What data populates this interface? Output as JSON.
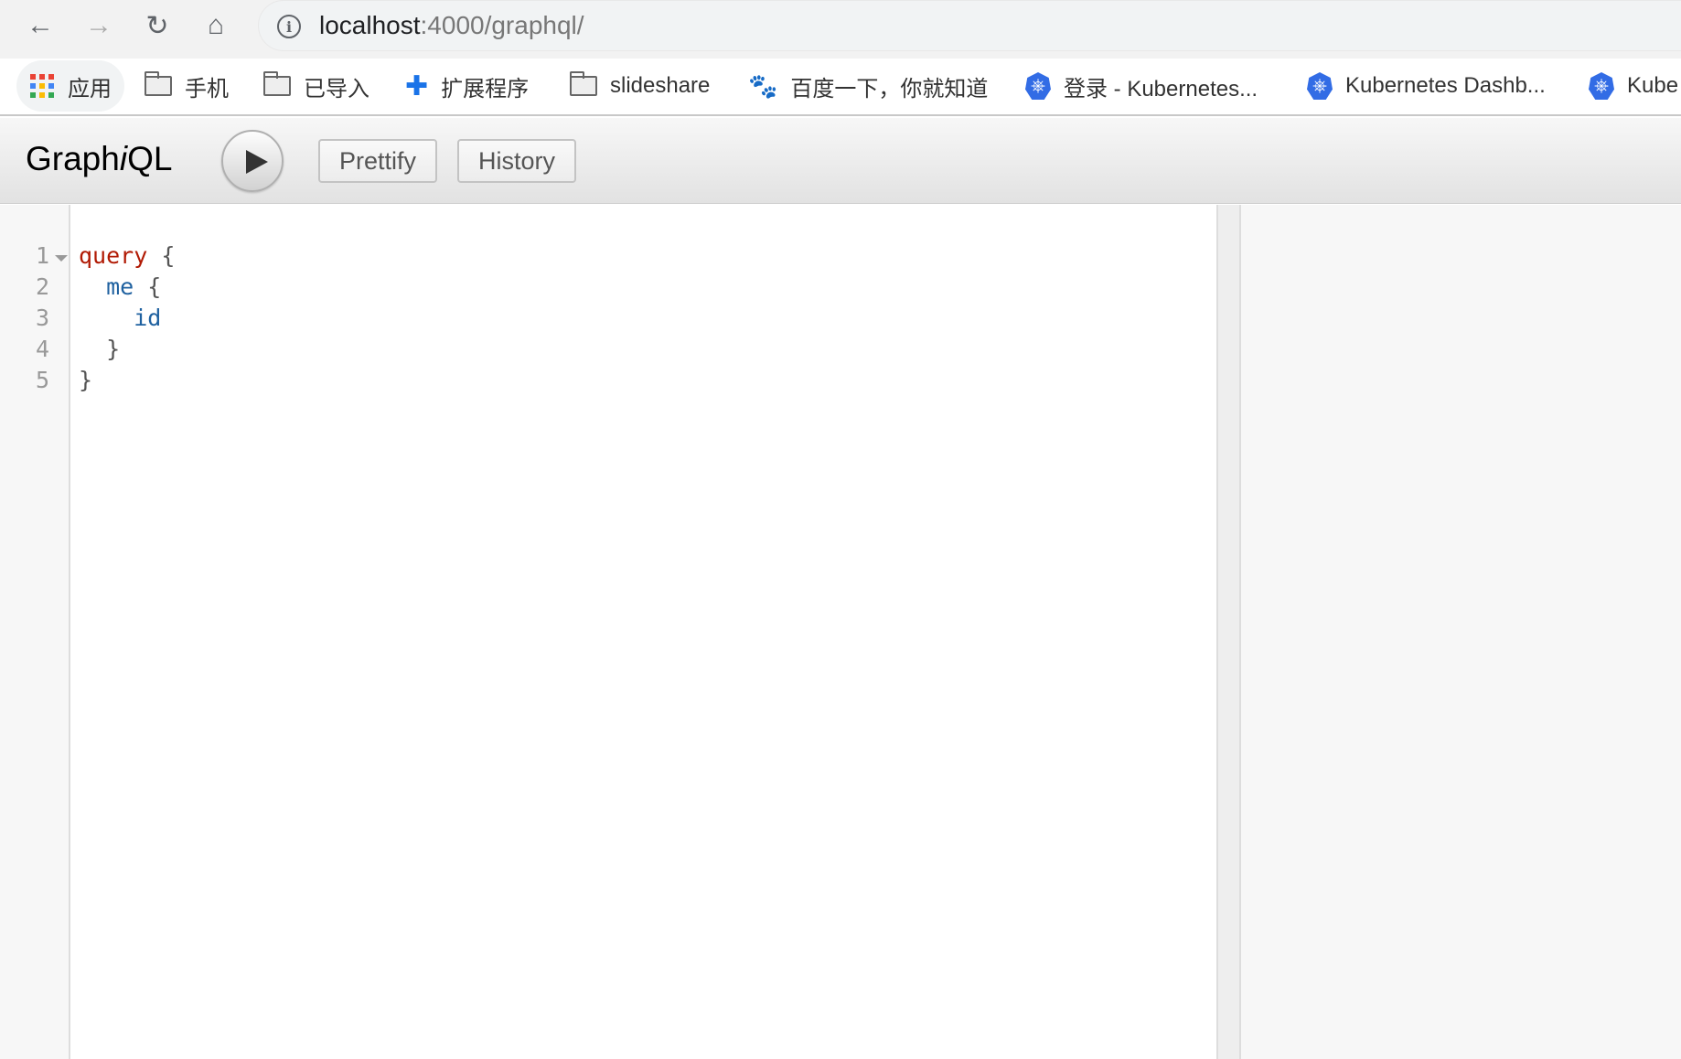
{
  "browser": {
    "url_host": "localhost",
    "url_rest": ":4000/graphql/",
    "bookmarks": [
      {
        "label": "应用",
        "icon": "apps-grid-icon"
      },
      {
        "label": "手机",
        "icon": "folder-icon"
      },
      {
        "label": "已导入",
        "icon": "folder-icon"
      },
      {
        "label": "扩展程序",
        "icon": "puzzle-icon"
      },
      {
        "label": "slideshare",
        "icon": "folder-icon"
      },
      {
        "label": "百度一下，你就知道",
        "icon": "baidu-paw-icon"
      },
      {
        "label": "登录 - Kubernetes...",
        "icon": "kubernetes-icon"
      },
      {
        "label": "Kubernetes Dashb...",
        "icon": "kubernetes-icon"
      },
      {
        "label": "Kube",
        "icon": "kubernetes-icon"
      }
    ]
  },
  "toolbar": {
    "logo_pre": "Graph",
    "logo_i": "i",
    "logo_post": "QL",
    "prettify_label": "Prettify",
    "history_label": "History"
  },
  "editor": {
    "line_numbers": [
      "1",
      "2",
      "3",
      "4",
      "5"
    ],
    "lines": [
      {
        "indent": "",
        "kw": "query",
        "fld": "",
        "punct": " {"
      },
      {
        "indent": "  ",
        "kw": "",
        "fld": "me",
        "punct": " {"
      },
      {
        "indent": "    ",
        "kw": "",
        "fld": "id",
        "punct": ""
      },
      {
        "indent": "  ",
        "kw": "",
        "fld": "",
        "punct": "}"
      },
      {
        "indent": "",
        "kw": "",
        "fld": "",
        "punct": "}"
      }
    ]
  }
}
